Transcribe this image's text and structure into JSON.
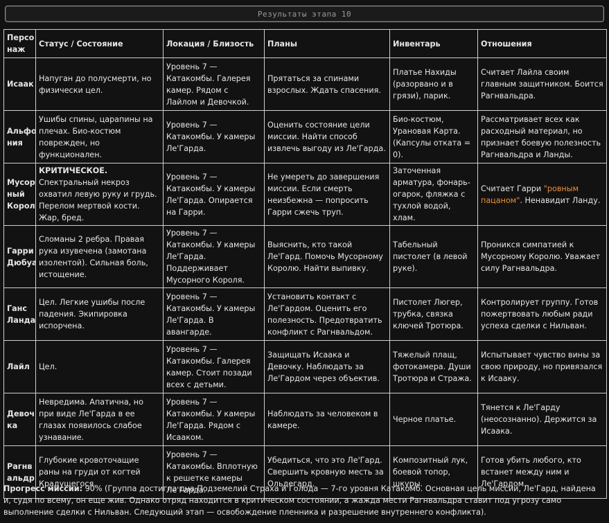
{
  "title": "Результаты этапа 10",
  "headers": [
    "Персо наж",
    "Статус / Состояние",
    "Локация / Близость",
    "Планы",
    "Инвентарь",
    "Отношения"
  ],
  "rows": [
    {
      "name": "Исаак",
      "status": "Напуган до полусмерти, но физически цел.",
      "location": "Уровень 7 — Катакомбы. Галерея камер. Рядом с Лайлом и Девочкой.",
      "plans": "Прятаться за спинами взрослых. Ждать спасения.",
      "inventory": "Платье Нахиды (разорвано и в грязи), парик.",
      "relations": "Считает Лайла своим главным защитником. Боится Рагнвальдра."
    },
    {
      "name": "Альфо ния",
      "status": "Ушибы спины, царапины на плечах. Био-костюм поврежден, но функционален.",
      "location": "Уровень 7 — Катакомбы. У камеры Ле'Гарда.",
      "plans": "Оценить состояние цели миссии. Найти способ извлечь выгоду из Ле'Гарда.",
      "inventory": "Био-костюм, Урановая Карта. (Капсулы отката = 0).",
      "relations": "Рассматривает всех как расходный материал, но признает боевую полезность Рагнвальдра и Ланды."
    },
    {
      "name": "Мусор ный Король",
      "status_bold": "КРИТИЧЕСКОЕ.",
      "status": " Спектральный некроз охватил левую руку и грудь. Перелом мертвой кости. Жар, бред.",
      "location": "Уровень 7 — Катакомбы. У камеры Ле'Гарда. Опирается на Гарри.",
      "plans": "Не умереть до завершения миссии. Если смерть неизбежна — попросить Гарри сжечь труп.",
      "inventory": "Заточенная арматура, фонарь-огарок, фляжка с тухлой водой, хлам.",
      "relations_pre": "Считает Гарри ",
      "relations_hl": "\"ровным пацаном\"",
      "relations_post": ". Ненавидит Ланду."
    },
    {
      "name": "Гарри Дюбуа",
      "status": "Сломаны 2 ребра. Правая рука изувечена (замотана изолентой). Сильная боль, истощение.",
      "location": "Уровень 7 — Катакомбы. У камеры Ле'Гарда. Поддерживает Мусорного Короля.",
      "plans": "Выяснить, кто такой Ле'Гард. Помочь Мусорному Королю. Найти выпивку.",
      "inventory": "Табельный пистолет (в левой руке).",
      "relations": "Проникся симпатией к Мусорному Королю. Уважает силу Рагнвальдра."
    },
    {
      "name": "Ганс Ланда",
      "status": "Цел. Легкие ушибы после падения. Экипировка испорчена.",
      "location": "Уровень 7 — Катакомбы. У камеры Ле'Гарда. В авангарде.",
      "plans": "Установить контакт с Ле'Гардом. Оценить его полезность. Предотвратить конфликт с Рагнвальдом.",
      "inventory": "Пистолет Люгер, трубка, связка ключей Тротюра.",
      "relations": "Контролирует группу. Готов пожертвовать любым ради успеха сделки с Нильван."
    },
    {
      "name": "Лайл",
      "status": "Цел.",
      "location": "Уровень 7 — Катакомбы. Галерея камер. Стоит позади всех с детьми.",
      "plans": "Защищать Исаака и Девочку. Наблюдать за Ле'Гардом через объектив.",
      "inventory": "Тяжелый плащ, фотокамера. Души Тротюра и Стража.",
      "relations": "Испытывает чувство вины за свою природу, но привязался к Исааку."
    },
    {
      "name": "Девоч ка",
      "status": "Невредима. Апатична, но при виде Ле'Гарда в ее глазах появилось слабое узнавание.",
      "location": "Уровень 7 — Катакомбы. У камеры Ле'Гарда. Рядом с Исааком.",
      "plans": "Наблюдать за человеком в камере.",
      "inventory": "Черное платье.",
      "relations": "Тянется к Ле'Гарду (неосознанно). Держится за Исаака."
    },
    {
      "name": "Рагнв альдр",
      "status": "Глубокие кровоточащие раны на груди от когтей Крадущегося.",
      "location": "Уровень 7 — Катакомбы. Вплотную к решетке камеры Ле'Гарда.",
      "plans": "Убедиться, что это Ле'Гард. Свершить кровную месть за Ольдегард.",
      "inventory": "Композитный лук, боевой топор, шкуры.",
      "relations": "Готов убить любого, кто встанет между ним и Ле'Гардом."
    }
  ],
  "footer": {
    "label": "Прогресс миссии:",
    "text": " 90% (Группа достигла дна Подземелий Страха и Голода — 7-го уровня Катакомб. Основная цель миссии, Ле'Гард, найдена и, судя по всему, он еще жив. Однако отряд находится в критическом состоянии, а жажда мести Рагнвальдра ставит под угрозу само выполнение сделки с Нильван. Следующий этап — освобождение пленника и разрешение внутреннего конфликта)."
  }
}
